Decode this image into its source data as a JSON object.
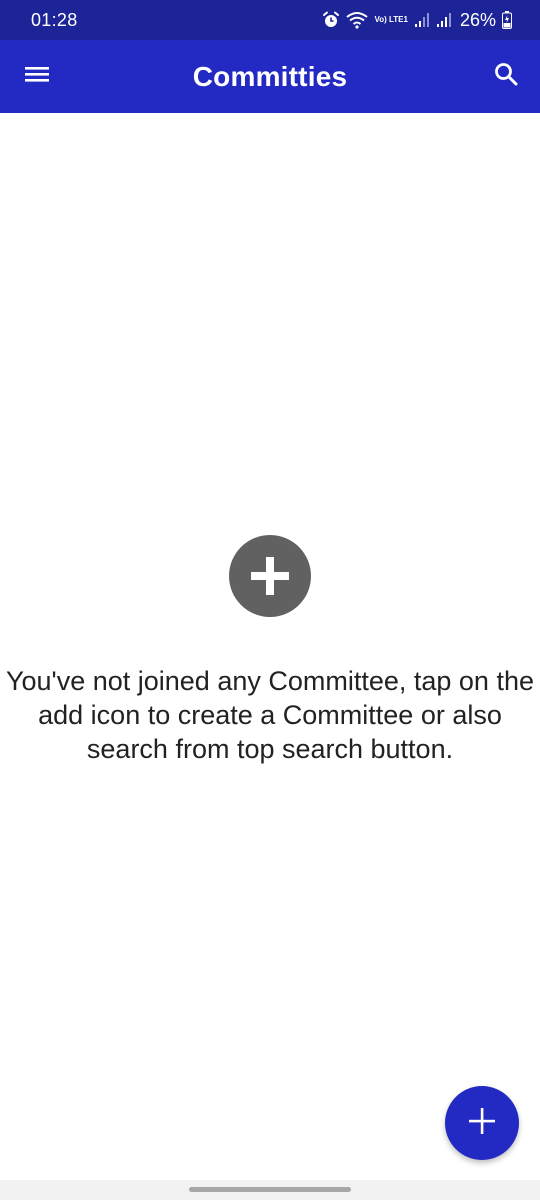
{
  "status_bar": {
    "time": "01:28",
    "network": "Vo) LTE1",
    "battery": "26%",
    "icons": [
      "alarm-icon",
      "wifi-icon",
      "signal-icon",
      "signal-icon",
      "battery-icon"
    ]
  },
  "app_bar": {
    "title": "Committies",
    "menu_icon": "hamburger-menu-icon",
    "search_icon": "search-icon"
  },
  "empty_state": {
    "icon": "add-circle-icon",
    "message": "You've not joined any Committee, tap on the add icon to create a Committee or also search from top search button."
  },
  "fab": {
    "icon": "plus-icon"
  },
  "colors": {
    "status_bar": "#1c2497",
    "app_bar": "#2329c3",
    "fab": "#2329c3",
    "empty_icon": "#616161",
    "text": "#222222"
  }
}
